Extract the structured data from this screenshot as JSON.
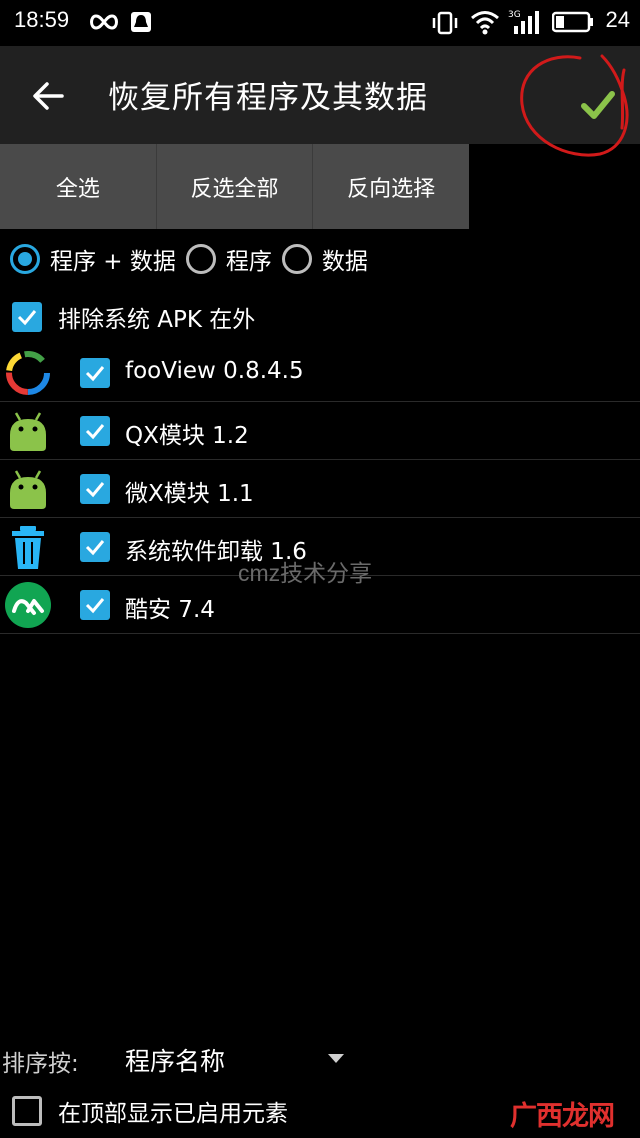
{
  "status_bar": {
    "time": "18:59",
    "battery_level": "24",
    "icons": [
      "infinity-icon",
      "notification-icon",
      "vibrate-icon",
      "wifi-icon",
      "signal-3g-icon",
      "battery-icon"
    ]
  },
  "toolbar": {
    "title": "恢复所有程序及其数据",
    "back_icon": "arrow-left-icon",
    "confirm_icon": "checkmark-icon",
    "accent_color": "#8bc34a",
    "annotation_color": "#d11a1a"
  },
  "selection_buttons": {
    "select_all": "全选",
    "deselect_all": "反选全部",
    "invert": "反向选择"
  },
  "mode_options": [
    {
      "label": "程序 + 数据",
      "checked": true
    },
    {
      "label": "程序",
      "checked": false
    },
    {
      "label": "数据",
      "checked": false
    }
  ],
  "exclude_system": {
    "label": "排除系统 APK 在外",
    "checked": true
  },
  "apps": [
    {
      "name": "fooView 0.8.4.5",
      "icon": "fooview-icon",
      "checked": true
    },
    {
      "name": "QX模块 1.2",
      "icon": "android-icon",
      "checked": true
    },
    {
      "name": "微X模块 1.1",
      "icon": "android-icon",
      "checked": true
    },
    {
      "name": "系统软件卸载 1.6",
      "icon": "trash-icon",
      "checked": true
    },
    {
      "name": "酷安 7.4",
      "icon": "coolapk-icon",
      "checked": true
    }
  ],
  "watermark": "cmz技术分享",
  "sort": {
    "label": "排序按:",
    "value": "程序名称"
  },
  "show_enabled_top": {
    "label": "在顶部显示已启用元素",
    "checked": false
  },
  "corner_logo": "广西龙网",
  "colors": {
    "accent": "#29a8e0",
    "toolbar": "#212121",
    "selbar": "#4a4a4a"
  }
}
